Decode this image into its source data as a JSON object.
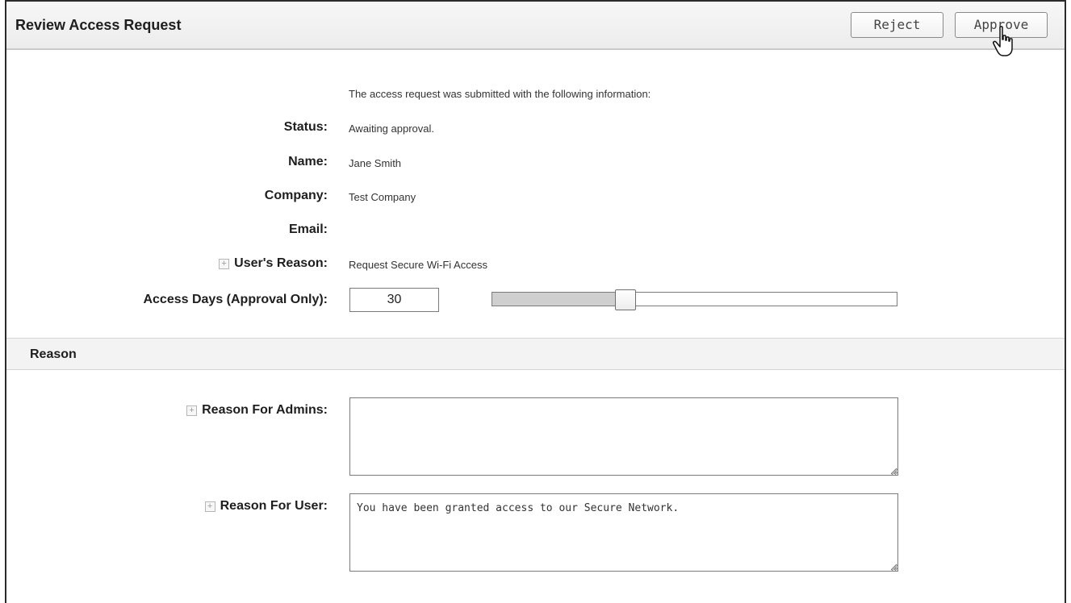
{
  "header": {
    "title": "Review Access Request",
    "reject_label": "Reject",
    "approve_label": "Approve"
  },
  "intro": "The access request was submitted with the following information:",
  "fields": {
    "status": {
      "label": "Status:",
      "value": "Awaiting approval."
    },
    "name": {
      "label": "Name:",
      "value": "Jane Smith"
    },
    "company": {
      "label": "Company:",
      "value": "Test Company"
    },
    "email": {
      "label": "Email:",
      "value": ""
    },
    "users_reason": {
      "label": "User's Reason:",
      "value": "Request Secure Wi-Fi Access"
    },
    "access_days": {
      "label": "Access Days (Approval Only):",
      "value": "30"
    }
  },
  "slider": {
    "value_fraction": 0.33
  },
  "reason_section": {
    "title": "Reason",
    "admins_label": "Reason For Admins:",
    "admins_value": "",
    "user_label": "Reason For User:",
    "user_value": "You have been granted access to our Secure Network."
  },
  "icons": {
    "expand": "plus-box-icon",
    "cursor": "hand-pointer-icon",
    "grip": "resize-grip-icon"
  },
  "colors": {
    "header_bg": "#efefef",
    "section_bg": "#f3f3f3",
    "slider_fill": "#cfcfcf",
    "border": "#7a7a7a"
  }
}
